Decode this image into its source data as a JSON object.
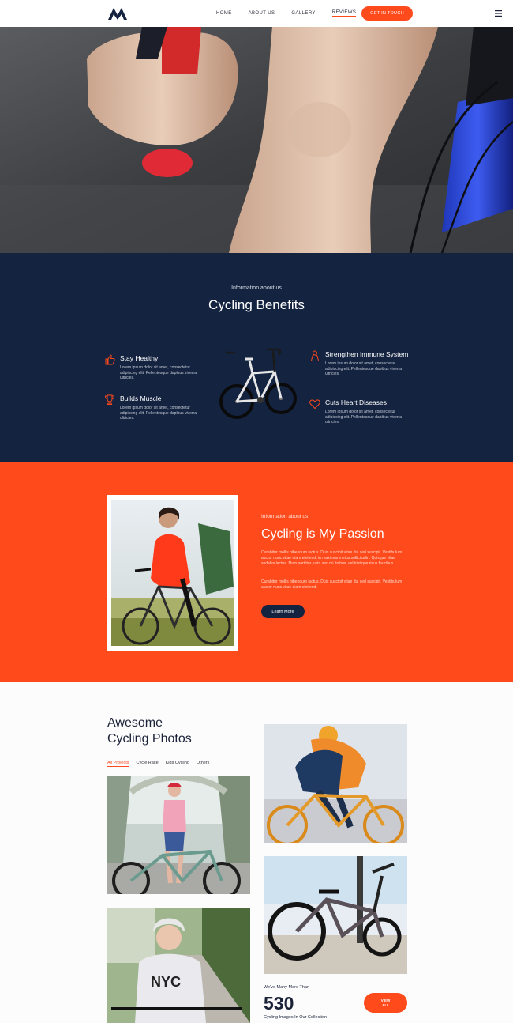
{
  "header": {
    "nav": [
      "HOME",
      "ABOUT US",
      "GALLERY",
      "REVIEWS"
    ],
    "active_nav": "REVIEWS",
    "cta_label": "GET IN TOUCH"
  },
  "benefits": {
    "eyebrow": "Information about us",
    "title": "Cycling Benefits",
    "items": [
      {
        "title": "Stay Healthy",
        "text": "Lorem ipsum dolor sit amet, consectetur adipiscing elit. Pellentesque dapibus viverra ultricies.",
        "icon": "thumbs-up-icon"
      },
      {
        "title": "Builds Muscle",
        "text": "Lorem ipsum dolor sit amet, consectetur adipiscing elit. Pellentesque dapibus viverra ultricies.",
        "icon": "trophy-icon"
      },
      {
        "title": "Strengthen Immune System",
        "text": "Lorem ipsum dolor sit amet, consectetur adipiscing elit. Pellentesque dapibus viverra ultricies.",
        "icon": "person-icon"
      },
      {
        "title": "Cuts Heart Diseases",
        "text": "Lorem ipsum dolor sit amet, consectetur adipiscing elit. Pellentesque dapibus viverra ultricies.",
        "icon": "heart-icon"
      }
    ]
  },
  "passion": {
    "eyebrow": "Information about us",
    "title": "Cycling is My Passion",
    "text1": "Curabitur mollis bibendum luctus. Duis suscipit vitae dui sed suscipit. Vestibulum auctor nunc vitae diam eleifend, in maximus metus sollicitudin. Quisque vitae sodales lectus. Nam porttitor justo sed mi finibus, vel tristique risus faucibus.",
    "text2": "Curabitur mollis bibendum luctus. Duis suscipit vitae dui sed suscipit. Vestibulum auctor nunc vitae diam eleifend.",
    "button": "Learn More"
  },
  "gallery": {
    "title_line1": "Awesome",
    "title_line2": "Cycling Photos",
    "tabs": [
      "All Projects",
      "Cycle Race",
      "Kids Cycling",
      "Others"
    ],
    "active_tab": "All Projects",
    "stat_label": "We've Many More Than",
    "stat_number": "530",
    "stat_sub": "Cycling Images In Our Collection",
    "view_line1": "VIEW",
    "view_line2": "ALL"
  },
  "colors": {
    "accent": "#ff4a1c",
    "navy": "#142340"
  }
}
